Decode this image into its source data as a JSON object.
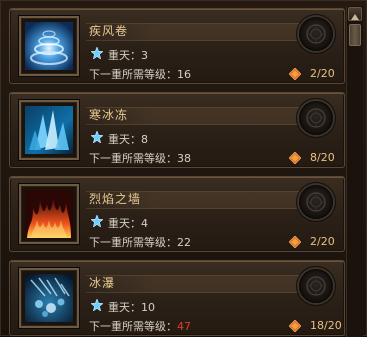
{
  "skills": [
    {
      "name": "疾风卷",
      "level_label": "重天：",
      "level": "3",
      "req_label": "下一重所需等级：",
      "req_level": "16",
      "req_met": true,
      "points": "2/20",
      "icon": "whirlwind-icon"
    },
    {
      "name": "寒冰冻",
      "level_label": "重天：",
      "level": "8",
      "req_label": "下一重所需等级：",
      "req_level": "38",
      "req_met": true,
      "points": "8/20",
      "icon": "ice-crystal-icon"
    },
    {
      "name": "烈焰之墙",
      "level_label": "重天：",
      "level": "4",
      "req_label": "下一重所需等级：",
      "req_level": "22",
      "req_met": true,
      "points": "2/20",
      "icon": "fire-wall-icon"
    },
    {
      "name": "冰瀑",
      "level_label": "重天：",
      "level": "10",
      "req_label": "下一重所需等级：",
      "req_level": "47",
      "req_met": false,
      "points": "18/20",
      "icon": "ice-cascade-icon"
    }
  ],
  "colors": {
    "name": "#e8c992",
    "text": "#d6d0c4",
    "req_unmet": "#e03a2c",
    "points": "#e9c083"
  }
}
